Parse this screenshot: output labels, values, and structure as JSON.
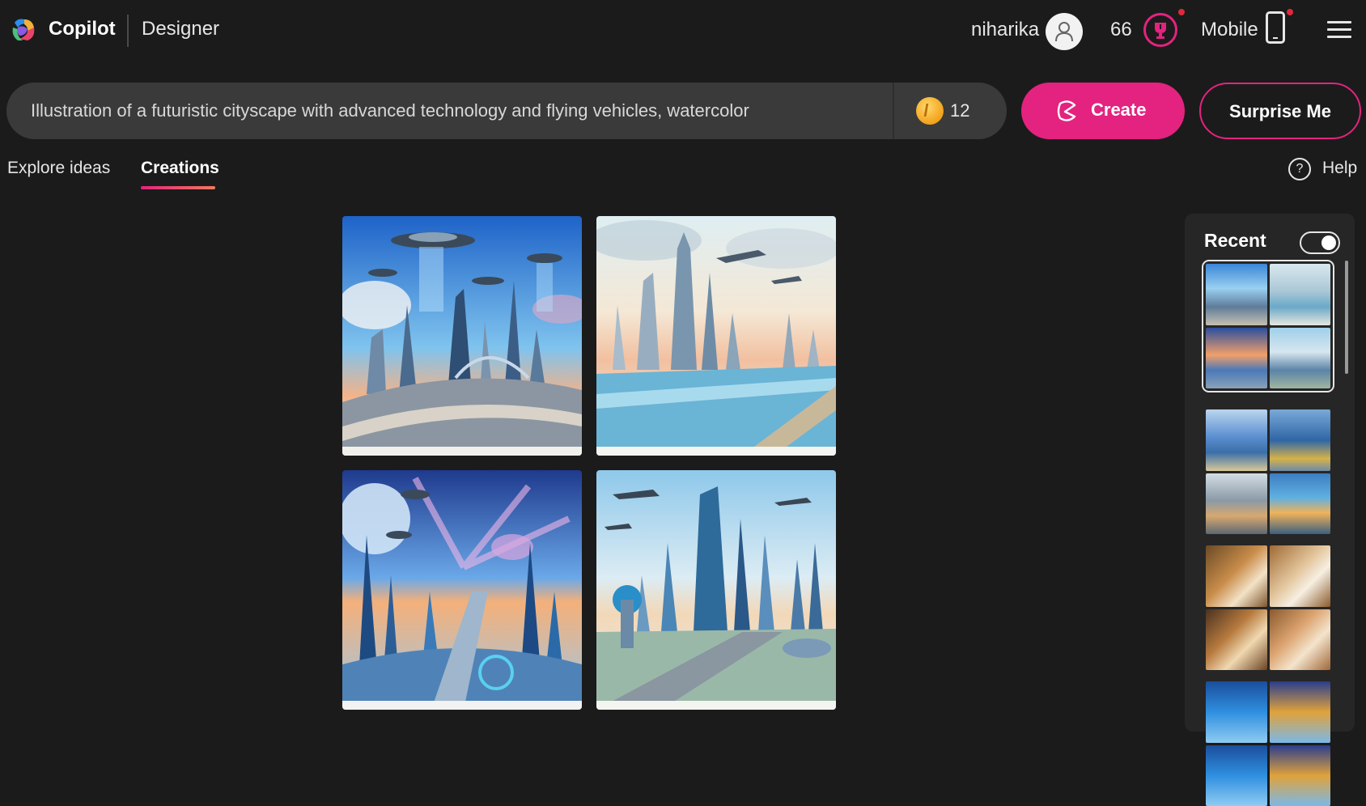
{
  "header": {
    "brand": "Copilot",
    "product": "Designer",
    "username": "niharika",
    "boost_count": "66",
    "mobile_label": "Mobile"
  },
  "prompt": {
    "value": "Illustration of a futuristic cityscape with advanced technology and flying vehicles, watercolor",
    "boosts": "12"
  },
  "buttons": {
    "create": "Create",
    "surprise": "Surprise Me"
  },
  "tabs": {
    "explore": "Explore ideas",
    "creations": "Creations",
    "active": "Creations"
  },
  "help": {
    "label": "Help"
  },
  "recent": {
    "title": "Recent",
    "toggle_on": true
  },
  "colors": {
    "accent": "#e3237f",
    "background": "#1b1b1b",
    "prompt_bg": "#3a3a3a"
  },
  "icons": [
    "copilot-logo",
    "user-icon",
    "rewards-icon",
    "phone-icon",
    "hamburger-menu-icon",
    "coin-icon",
    "create-icon",
    "help-icon",
    "toggle-switch"
  ]
}
